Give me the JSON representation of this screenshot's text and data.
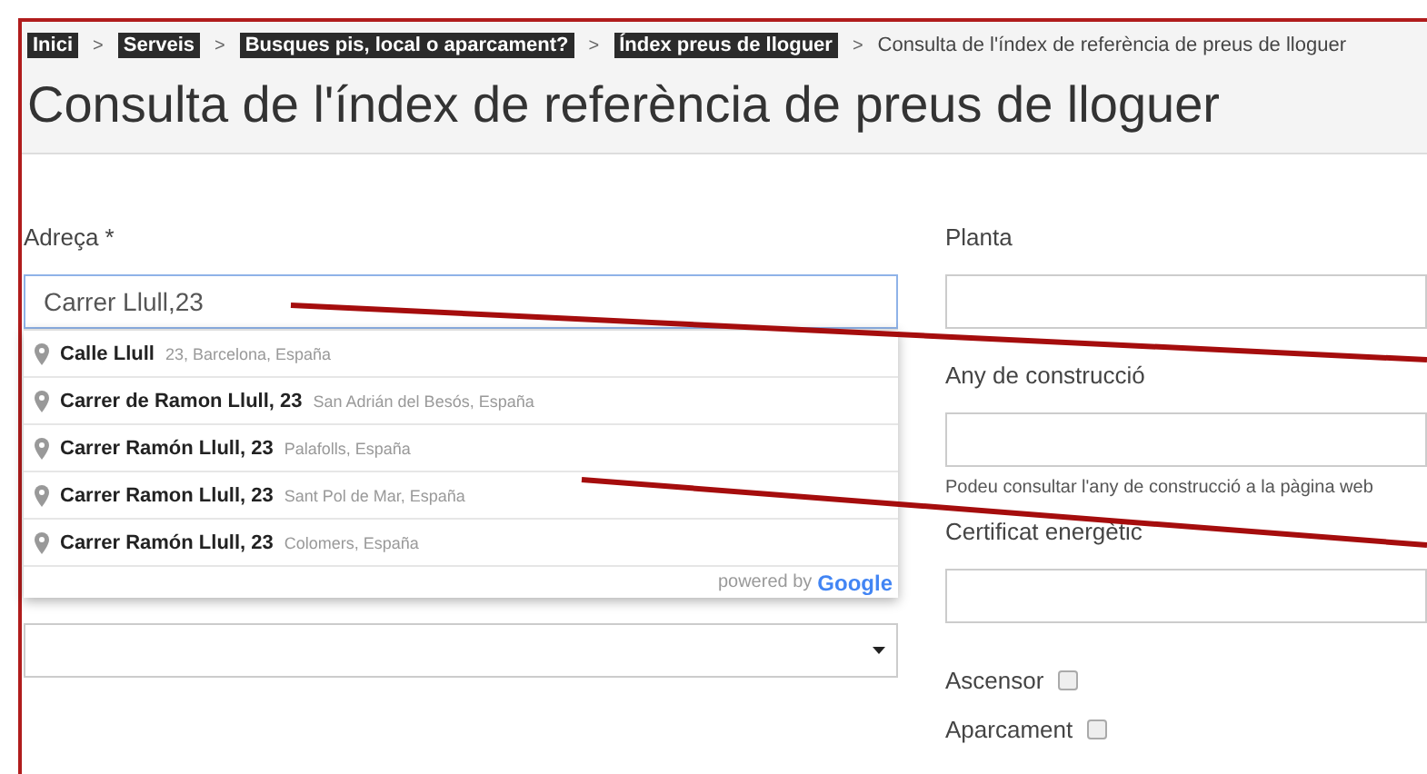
{
  "breadcrumbs": [
    {
      "label": "Inici",
      "kind": "link"
    },
    {
      "label": "Serveis",
      "kind": "link"
    },
    {
      "label": "Busques pis, local o aparcament?",
      "kind": "link"
    },
    {
      "label": "Índex preus de lloguer",
      "kind": "link"
    },
    {
      "label": "Consulta de l'índex de referència de preus de lloguer",
      "kind": "current"
    }
  ],
  "breadcrumb_separator": ">",
  "title": "Consulta de l'índex de referència de preus de lloguer",
  "address": {
    "label": "Adreça *",
    "value": "Carrer Llull,23"
  },
  "suggestions": [
    {
      "main": "Calle Llull",
      "secondary": "23, Barcelona, España"
    },
    {
      "main": "Carrer de Ramon Llull, 23",
      "secondary": "San Adrián del Besós, España"
    },
    {
      "main": "Carrer Ramón Llull, 23",
      "secondary": "Palafolls, España"
    },
    {
      "main": "Carrer Ramon Llull, 23",
      "secondary": "Sant Pol de Mar, España"
    },
    {
      "main": "Carrer Ramón Llull, 23",
      "secondary": "Colomers, España"
    }
  ],
  "attribution": {
    "prefix": "powered by",
    "brand": "Google"
  },
  "right_fields": [
    {
      "label": "Planta"
    },
    {
      "label": "Any de construcció",
      "help": "Podeu consultar l'any de construcció a la pàgina web"
    },
    {
      "label": "Certificat energètic"
    }
  ],
  "checkboxes": [
    {
      "label": "Ascensor",
      "checked": false
    },
    {
      "label": "Aparcament",
      "checked": false
    }
  ]
}
